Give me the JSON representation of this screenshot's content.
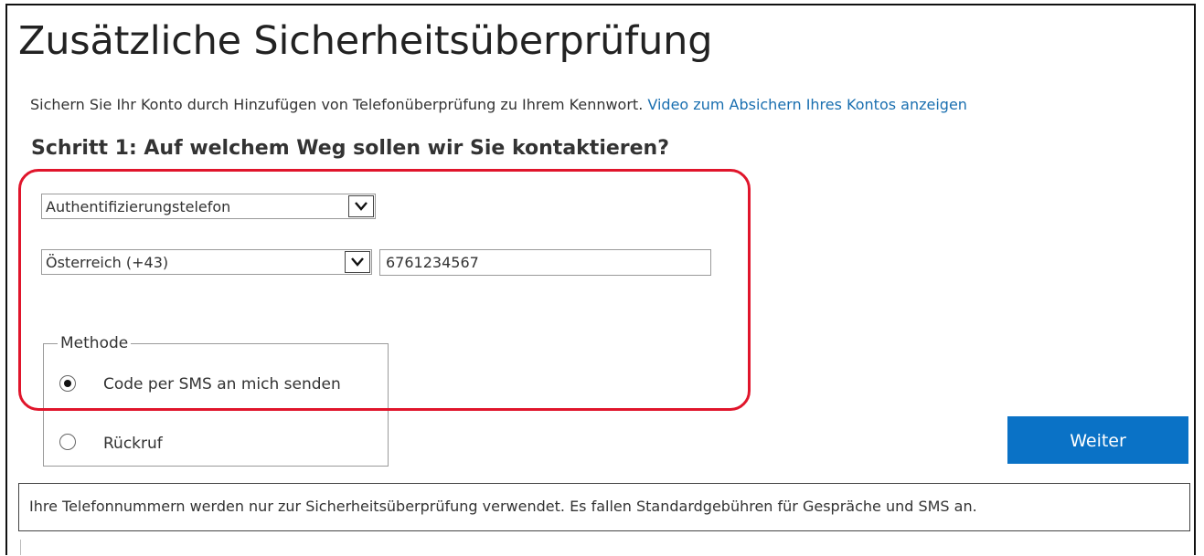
{
  "page": {
    "title": "Zusätzliche Sicherheitsüberprüfung",
    "intro_text": "Sichern Sie Ihr Konto durch Hinzufügen von Telefonüberprüfung zu Ihrem Kennwort.",
    "intro_link": "Video zum Absichern Ihres Kontos anzeigen",
    "step_heading": "Schritt 1: Auf welchem Weg sollen wir Sie kontaktieren?"
  },
  "form": {
    "contact_method": "Authentifizierungstelefon",
    "country": "Österreich (+43)",
    "phone_number": "6761234567",
    "method_legend": "Methode",
    "options": [
      {
        "label": "Code per SMS an mich senden",
        "selected": true
      },
      {
        "label": "Rückruf",
        "selected": false
      }
    ],
    "next_button": "Weiter"
  },
  "notice": "Ihre Telefonnummern werden nur zur Sicherheitsüberprüfung verwendet. Es fallen Standardgebühren für Gespräche und SMS an.",
  "colors": {
    "accent": "#0a72c6",
    "link": "#1a6fb0",
    "highlight": "#e0152b"
  }
}
